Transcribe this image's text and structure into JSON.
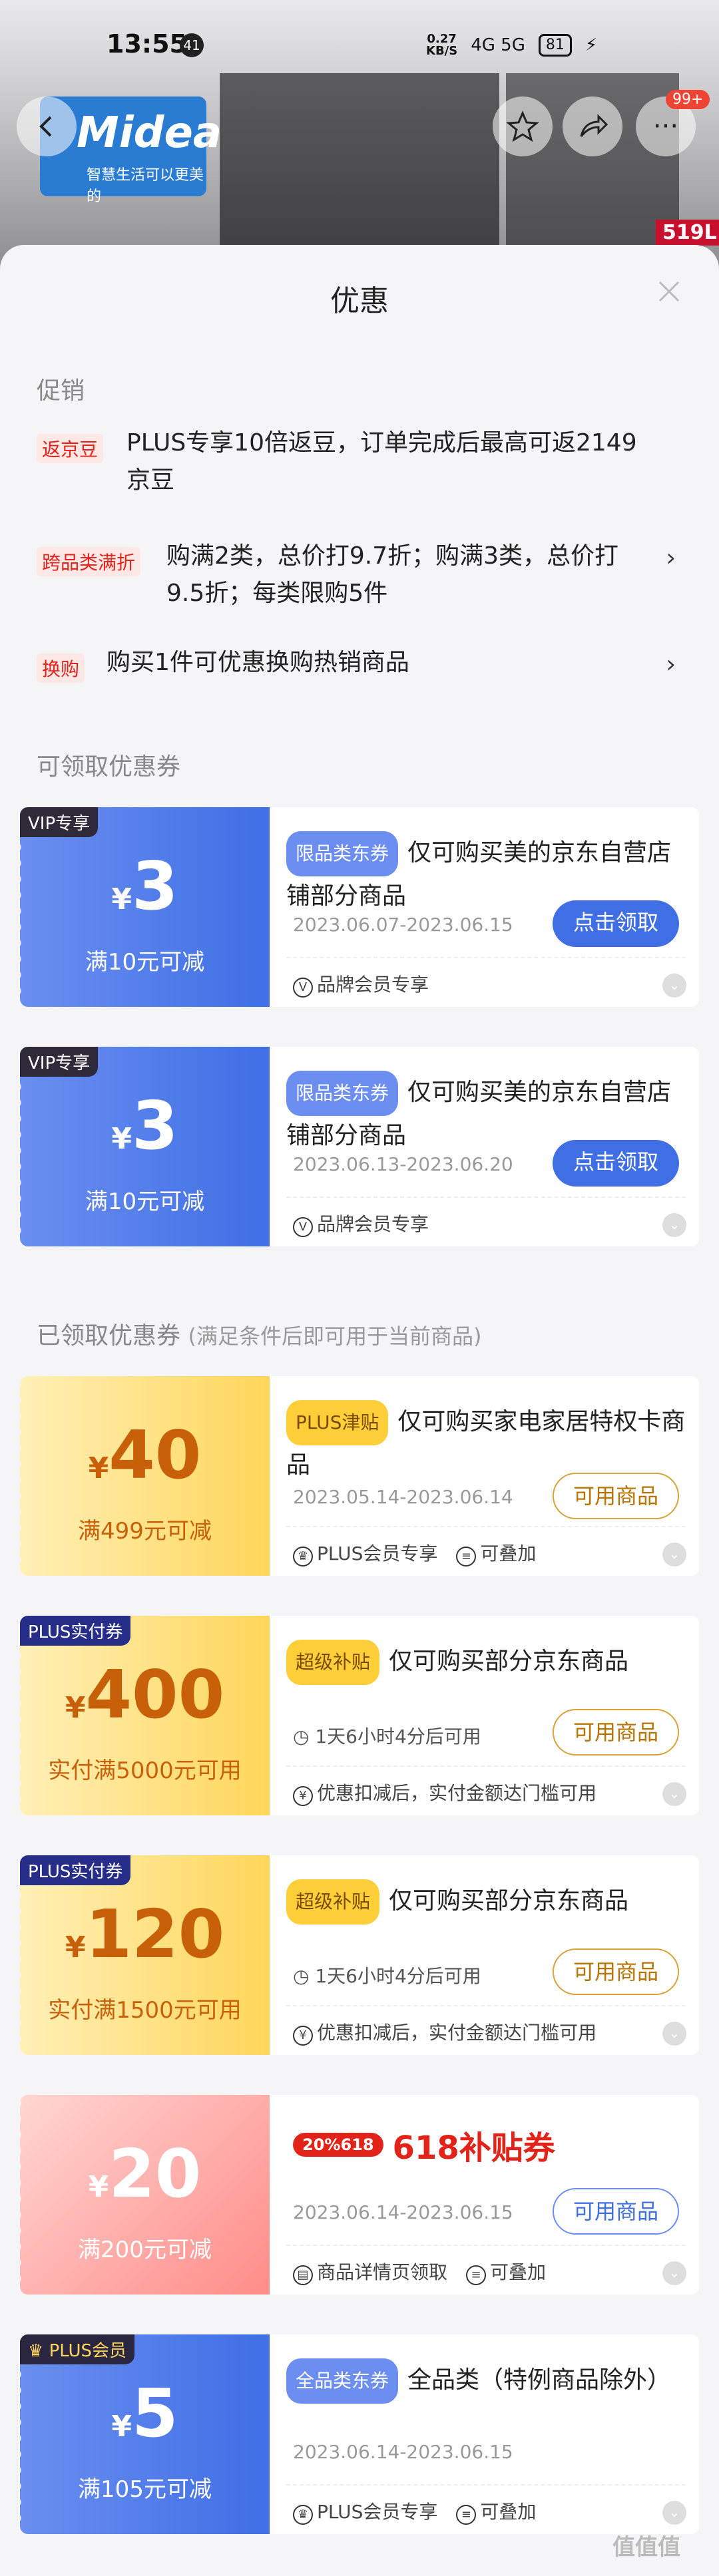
{
  "status_bar": {
    "time": "13:55",
    "notif_count": "41",
    "speed": "0.27\nKB/S",
    "signal": "4G 5G",
    "battery": "81"
  },
  "header": {
    "brand": "Midea",
    "brand_slogan": "智慧生活可以更美的",
    "cart_badge": "99+",
    "size_label": "519L"
  },
  "sheet": {
    "title": "优惠"
  },
  "promo": {
    "section_label": "促销",
    "items": [
      {
        "tag": "返京豆",
        "text": "PLUS专享10倍返豆，订单完成后最高可返2149京豆",
        "chevron": ""
      },
      {
        "tag": "跨品类满折",
        "text": "购满2类，总价打9.7折；购满3类，总价打9.5折；每类限购5件",
        "chevron": "›"
      },
      {
        "tag": "换购",
        "text": "购买1件可优惠换购热销商品",
        "chevron": "›"
      }
    ]
  },
  "claimable": {
    "section_label": "可领取优惠券",
    "coupons": [
      {
        "corner": "VIP专享",
        "currency": "¥",
        "amount": "3",
        "condition": "满10元可减",
        "badge": "限品类东券",
        "title": "仅可购买美的京东自营店铺部分商品",
        "date": "2023.06.07-2023.06.15",
        "button": "点击领取",
        "footer": [
          "品牌会员专享"
        ]
      },
      {
        "corner": "VIP专享",
        "currency": "¥",
        "amount": "3",
        "condition": "满10元可减",
        "badge": "限品类东券",
        "title": "仅可购买美的京东自营店铺部分商品",
        "date": "2023.06.13-2023.06.20",
        "button": "点击领取",
        "footer": [
          "品牌会员专享"
        ]
      }
    ]
  },
  "received": {
    "section_label": "已领取优惠券",
    "section_note": "(满足条件后即可用于当前商品)",
    "coupons": [
      {
        "corner": "",
        "currency": "¥",
        "amount": "40",
        "condition": "满499元可减",
        "badge": "PLUS津贴",
        "title": "仅可购买家电家居特权卡商品",
        "date": "2023.05.14-2023.06.14",
        "button": "可用商品",
        "footer": [
          "PLUS会员专享",
          "可叠加"
        ]
      },
      {
        "corner": "PLUS实付券",
        "currency": "¥",
        "amount": "400",
        "condition": "实付满5000元可用",
        "badge": "超级补贴",
        "title": "仅可购买部分京东商品",
        "date": "1天6小时4分后可用",
        "button": "可用商品",
        "footer": [
          "优惠扣减后，实付金额达门槛可用"
        ]
      },
      {
        "corner": "PLUS实付券",
        "currency": "¥",
        "amount": "120",
        "condition": "实付满1500元可用",
        "badge": "超级补贴",
        "title": "仅可购买部分京东商品",
        "date": "1天6小时4分后可用",
        "button": "可用商品",
        "footer": [
          "优惠扣减后，实付金额达门槛可用"
        ]
      },
      {
        "corner": "",
        "currency": "¥",
        "amount": "20",
        "condition": "满200元可减",
        "badge": "20%618",
        "title": "618补贴券",
        "date": "2023.06.14-2023.06.15",
        "button": "可用商品",
        "footer": [
          "商品详情页领取",
          "可叠加"
        ]
      },
      {
        "corner": "PLUS会员",
        "currency": "¥",
        "amount": "5",
        "condition": "满105元可减",
        "badge": "全品类东券",
        "title": "全品类（特例商品除外）",
        "date": "2023.06.14-2023.06.15",
        "button": "",
        "footer": [
          "PLUS会员专享",
          "可叠加"
        ]
      }
    ]
  },
  "watermark": "值值值"
}
